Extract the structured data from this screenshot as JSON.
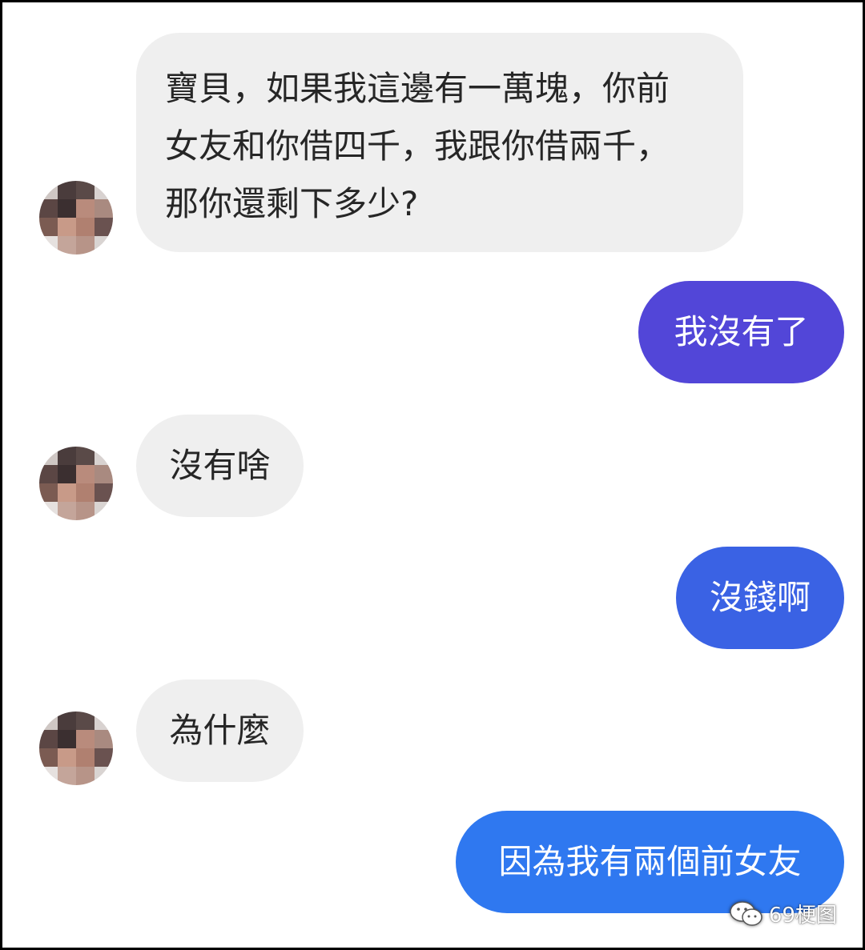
{
  "messages": [
    {
      "side": "in",
      "text": "寶貝，如果我這邊有一萬塊，你前\n女友和你借四千，我跟你借兩千，\n那你還剩下多少?"
    },
    {
      "side": "out",
      "text": "我沒有了",
      "color": "#5246d8"
    },
    {
      "side": "in",
      "text": "沒有啥"
    },
    {
      "side": "out",
      "text": "沒錢啊",
      "color": "#3a62e4"
    },
    {
      "side": "in",
      "text": "為什麼"
    },
    {
      "side": "out",
      "text": "因為我有兩個前女友",
      "color": "#2f78f0"
    }
  ],
  "avatar": {
    "icon": "pixelated-avatar-icon"
  },
  "watermark": {
    "icon": "wechat-icon",
    "text": "69梗图"
  }
}
